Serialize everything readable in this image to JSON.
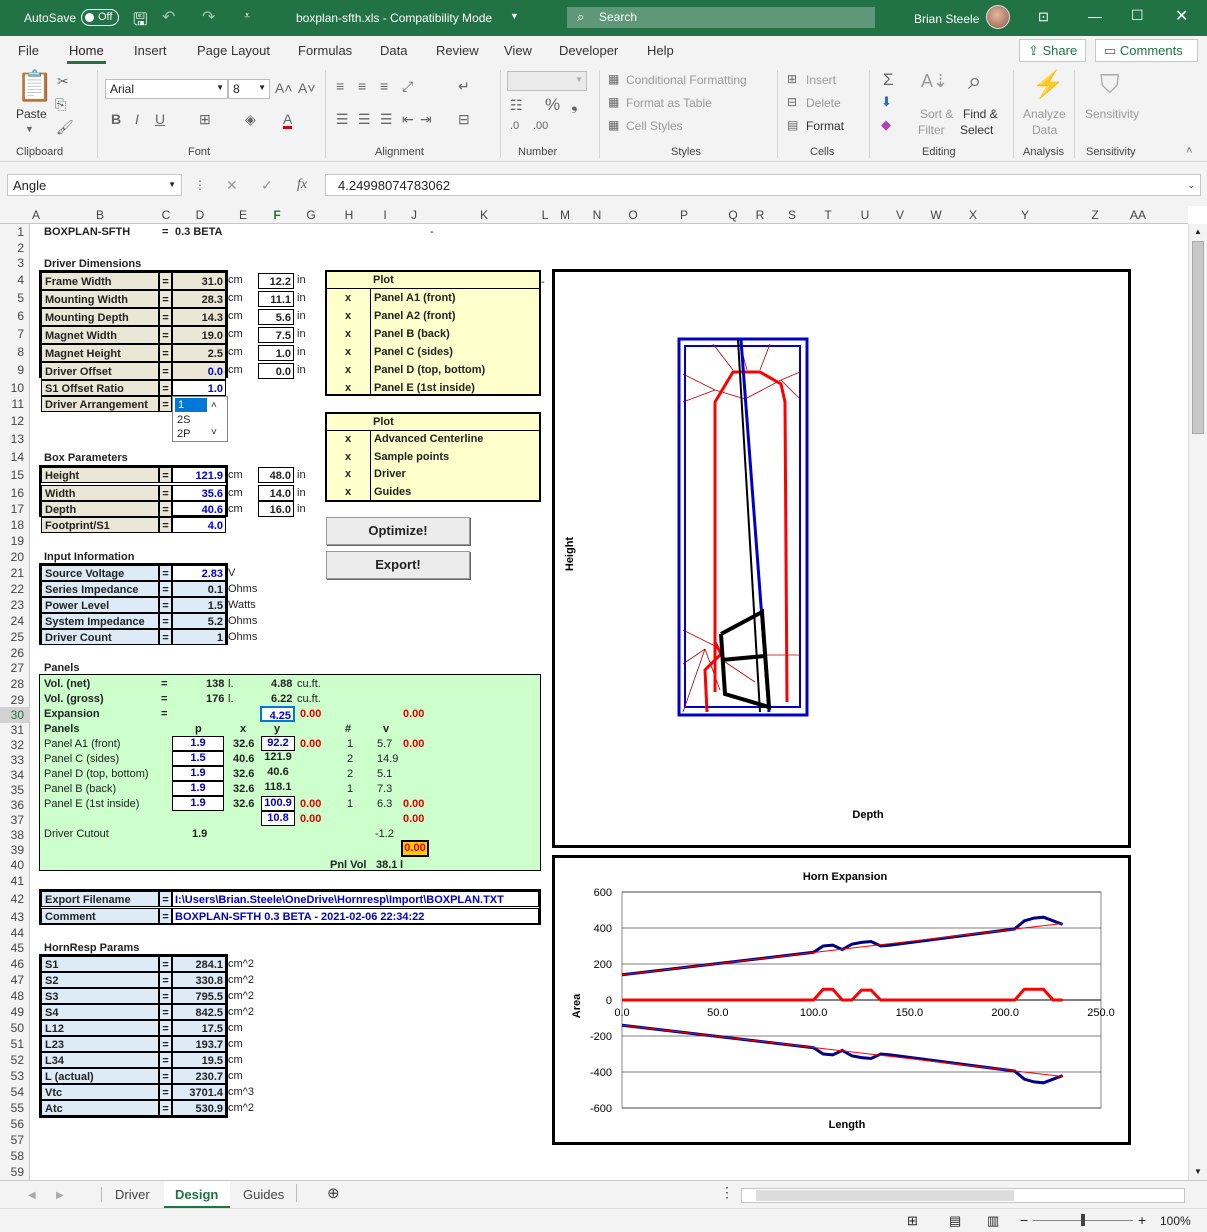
{
  "titlebar": {
    "autosave": "AutoSave",
    "toggle": "Off",
    "filename": "boxplan-sfth.xls - Compatibility Mode",
    "search": "Search",
    "user": "Brian Steele"
  },
  "tabs": [
    "File",
    "Home",
    "Insert",
    "Page Layout",
    "Formulas",
    "Data",
    "Review",
    "View",
    "Developer",
    "Help"
  ],
  "share": "Share",
  "comments": "Comments",
  "ribbon": {
    "paste": "Paste",
    "font": "Arial",
    "size": "8",
    "cond": "Conditional Formatting",
    "fmt_table": "Format as Table",
    "cell_styles": "Cell Styles",
    "insert": "Insert",
    "delete": "Delete",
    "format": "Format",
    "sort": "Sort &",
    "filter": "Filter",
    "find": "Find &",
    "select": "Select",
    "analyze": "Analyze",
    "analyze2": "Data",
    "sensitivity": "Sensitivity",
    "groups": [
      "Clipboard",
      "Font",
      "Alignment",
      "Number",
      "Styles",
      "Cells",
      "Editing",
      "Analysis",
      "Sensitivity"
    ]
  },
  "namebox": "Angle",
  "formula": "4.24998074783062",
  "cols": [
    "A",
    "B",
    "C",
    "D",
    "E",
    "F",
    "G",
    "H",
    "I",
    "J",
    "K",
    "L",
    "M",
    "N",
    "O",
    "P",
    "Q",
    "R",
    "S",
    "T",
    "U",
    "V",
    "W",
    "X",
    "Y",
    "Z",
    "AA"
  ],
  "rows": [
    "1",
    "2",
    "3",
    "4",
    "5",
    "6",
    "7",
    "8",
    "9",
    "10",
    "11",
    "12",
    "13",
    "14",
    "15",
    "16",
    "17",
    "18",
    "19",
    "20",
    "21",
    "22",
    "23",
    "24",
    "25",
    "26",
    "27",
    "28",
    "29",
    "30",
    "31",
    "32",
    "33",
    "34",
    "35",
    "36",
    "37",
    "38",
    "39",
    "40",
    "41",
    "42",
    "43",
    "44",
    "45",
    "46",
    "47",
    "48",
    "49",
    "50",
    "51",
    "52",
    "53",
    "54",
    "55",
    "56",
    "57",
    "58",
    "59"
  ],
  "header": {
    "title": "BOXPLAN-SFTH",
    "eq": "=",
    "ver": "0.3 BETA",
    "dash": "-"
  },
  "driver_dims": {
    "title": "Driver Dimensions",
    "rows": [
      {
        "label": "Frame Width",
        "cm": "31.0",
        "in": "12.2"
      },
      {
        "label": "Mounting Width",
        "cm": "28.3",
        "in": "11.1"
      },
      {
        "label": "Mounting Depth",
        "cm": "14.3",
        "in": "5.6"
      },
      {
        "label": "Magnet Width",
        "cm": "19.0",
        "in": "7.5"
      },
      {
        "label": "Magnet Height",
        "cm": "2.5",
        "in": "1.0"
      },
      {
        "label": "Driver Offset",
        "cm": "0.0",
        "in": "0.0"
      }
    ],
    "s1_label": "S1 Offset Ratio",
    "s1_val": "1.0",
    "arr_label": "Driver Arrangement",
    "arr_val": "1",
    "arr_opts": [
      "1",
      "2S",
      "2P"
    ],
    "unit_cm": "cm",
    "unit_in": "in"
  },
  "plot1": {
    "title": "Plot",
    "mark": "x",
    "items": [
      "Panel A1 (front)",
      "Panel A2 (front)",
      "Panel B (back)",
      "Panel C (sides)",
      "Panel D (top, bottom)",
      "Panel E (1st inside)"
    ]
  },
  "plot2": {
    "title": "Plot",
    "mark": "x",
    "items": [
      "Advanced Centerline",
      "Sample points",
      "Driver",
      "Guides"
    ]
  },
  "box": {
    "title": "Box Parameters",
    "rows": [
      {
        "label": "Height",
        "cm": "121.9",
        "in": "48.0"
      },
      {
        "label": "Width",
        "cm": "35.6",
        "in": "14.0"
      },
      {
        "label": "Depth",
        "cm": "40.6",
        "in": "16.0"
      }
    ],
    "fp_label": "Footprint/S1",
    "fp_val": "4.0"
  },
  "buttons": {
    "optimize": "Optimize!",
    "export": "Export!"
  },
  "input": {
    "title": "Input Information",
    "rows": [
      {
        "label": "Source Voltage",
        "val": "2.83",
        "unit": "V"
      },
      {
        "label": "Series Impedance",
        "val": "0.1",
        "unit": "Ohms"
      },
      {
        "label": "Power Level",
        "val": "1.5",
        "unit": "Watts"
      },
      {
        "label": "System Impedance",
        "val": "5.2",
        "unit": "Ohms"
      },
      {
        "label": "Driver Count",
        "val": "1",
        "unit": "Ohms"
      }
    ]
  },
  "panels": {
    "title": "Panels",
    "vol_net": {
      "label": "Vol. (net)",
      "l": "138",
      "lu": "l.",
      "cf": "4.88",
      "cfu": "cu.ft."
    },
    "vol_gross": {
      "label": "Vol. (gross)",
      "l": "176",
      "lu": "l.",
      "cf": "6.22",
      "cfu": "cu.ft."
    },
    "exp": {
      "label": "Expansion",
      "val": "4.25",
      "r1": "0.00",
      "r2": "0.00"
    },
    "hdr": {
      "label": "Panels",
      "p": "p",
      "x": "x",
      "y": "y",
      "n": "#",
      "v": "v"
    },
    "rows": [
      {
        "label": "Panel A1 (front)",
        "p": "1.9",
        "x": "32.6",
        "y": "92.2",
        "yr": "0.00",
        "n": "1",
        "v": "5.7",
        "vr": "0.00"
      },
      {
        "label": "Panel C (sides)",
        "p": "1.5",
        "x": "40.6",
        "y": "121.9",
        "yr": "",
        "n": "2",
        "v": "14.9",
        "vr": ""
      },
      {
        "label": "Panel D (top, bottom)",
        "p": "1.9",
        "x": "32.6",
        "y": "40.6",
        "yr": "",
        "n": "2",
        "v": "5.1",
        "vr": ""
      },
      {
        "label": "Panel B (back)",
        "p": "1.9",
        "x": "32.6",
        "y": "118.1",
        "yr": "",
        "n": "1",
        "v": "7.3",
        "vr": ""
      },
      {
        "label": "Panel E (1st inside)",
        "p": "1.9",
        "x": "32.6",
        "y": "100.9",
        "yr": "0.00",
        "n": "1",
        "v": "6.3",
        "vr": "0.00"
      }
    ],
    "extra_y": "10.8",
    "extra_r": "0.00",
    "extra_vr": "0.00",
    "cutout_label": "Driver Cutout",
    "cutout_val": "1.9",
    "cutout_v": "-1.2",
    "yellow": "0.00",
    "pnl_label": "Pnl Vol",
    "pnl_val": "38.1",
    "pnl_unit": "l"
  },
  "export": {
    "fn_label": "Export Filename",
    "fn_val": "I:\\Users\\Brian.Steele\\OneDrive\\Hornresp\\Import\\BOXPLAN.TXT",
    "cm_label": "Comment",
    "cm_val": "BOXPLAN-SFTH 0.3 BETA - 2021-02-06 22:34:22"
  },
  "hornresp": {
    "title": "HornResp Params",
    "rows": [
      {
        "label": "S1",
        "val": "284.1",
        "unit": "cm^2"
      },
      {
        "label": "S2",
        "val": "330.8",
        "unit": "cm^2"
      },
      {
        "label": "S3",
        "val": "795.5",
        "unit": "cm^2"
      },
      {
        "label": "S4",
        "val": "842.5",
        "unit": "cm^2"
      },
      {
        "label": "L12",
        "val": "17.5",
        "unit": "cm"
      },
      {
        "label": "L23",
        "val": "193.7",
        "unit": "cm"
      },
      {
        "label": "L34",
        "val": "19.5",
        "unit": "cm"
      },
      {
        "label": "L (actual)",
        "val": "230.7",
        "unit": "cm"
      },
      {
        "label": "Vtc",
        "val": "3701.4",
        "unit": "cm^3"
      },
      {
        "label": "Atc",
        "val": "530.9",
        "unit": "cm^2"
      }
    ]
  },
  "diagram": {
    "ylabel": "Height",
    "xlabel": "Depth"
  },
  "chart_data": {
    "type": "line",
    "title": "Horn Expansion",
    "xlabel": "Length",
    "ylabel": "Area",
    "xlim": [
      0,
      250
    ],
    "ylim": [
      -600,
      600
    ],
    "xticks": [
      "0.0",
      "50.0",
      "100.0",
      "150.0",
      "200.0",
      "250.0"
    ],
    "yticks": [
      "600",
      "400",
      "200",
      "0",
      "-200",
      "-400",
      "-600"
    ],
    "series": [
      {
        "color": "#000080",
        "x": [
          0,
          100,
          105,
          110,
          115,
          120,
          125,
          130,
          135,
          140,
          205,
          210,
          215,
          220,
          225,
          230
        ],
        "y": [
          140,
          265,
          300,
          305,
          280,
          310,
          320,
          325,
          300,
          305,
          395,
          440,
          455,
          460,
          440,
          420
        ]
      },
      {
        "color": "#ff0000",
        "x": [
          0,
          100,
          105,
          110,
          115,
          120,
          125,
          130,
          135,
          140,
          205,
          210,
          215,
          220,
          225,
          230
        ],
        "y": [
          0,
          0,
          60,
          60,
          0,
          0,
          55,
          55,
          0,
          0,
          0,
          60,
          60,
          60,
          0,
          0
        ]
      },
      {
        "color": "#000080",
        "x": [
          0,
          100,
          105,
          110,
          115,
          120,
          125,
          130,
          135,
          140,
          205,
          210,
          215,
          220,
          225,
          230
        ],
        "y": [
          -140,
          -265,
          -300,
          -305,
          -280,
          -310,
          -320,
          -325,
          -300,
          -305,
          -395,
          -440,
          -455,
          -460,
          -440,
          -420
        ]
      },
      {
        "color": "#ff0000",
        "x": [
          0,
          230
        ],
        "y": [
          140,
          425
        ]
      },
      {
        "color": "#ff0000",
        "x": [
          0,
          230
        ],
        "y": [
          -140,
          -425
        ]
      }
    ]
  },
  "sheet_tabs": [
    "Driver",
    "Design",
    "Guides"
  ],
  "status": {
    "zoom": "100%"
  }
}
